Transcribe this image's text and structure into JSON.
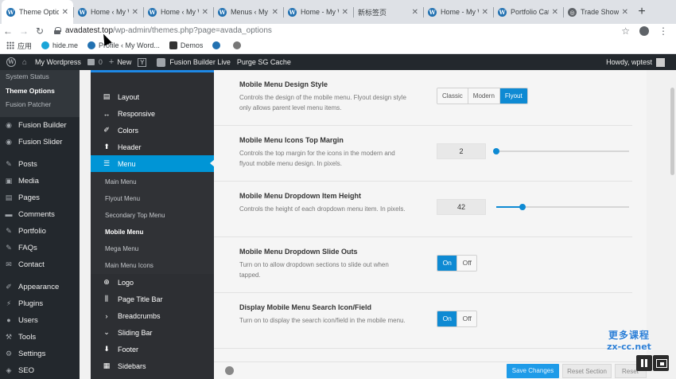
{
  "browser": {
    "tabs": [
      {
        "label": "Theme Optio",
        "icon": "wordpress-icon",
        "active": true
      },
      {
        "label": "Home ‹ My W",
        "icon": "wordpress-icon"
      },
      {
        "label": "Home ‹ My W",
        "icon": "wordpress-icon"
      },
      {
        "label": "Menus ‹ My W",
        "icon": "wordpress-icon"
      },
      {
        "label": "Home - My W",
        "icon": "wordpress-icon"
      },
      {
        "label": "新标签页",
        "icon": "none"
      },
      {
        "label": "Home - My W",
        "icon": "wordpress-icon"
      },
      {
        "label": "Portfolio Cat",
        "icon": "wordpress-icon"
      },
      {
        "label": "Trade Show E",
        "icon": "globe-icon"
      }
    ],
    "new_tab": "+",
    "url_host": "avadatest.top",
    "url_path": "/wp-admin/themes.php?page=avada_options",
    "bookmarks": [
      {
        "label": "应用",
        "icon": "apps-grid-icon"
      },
      {
        "label": "hide.me",
        "icon": "hideme-icon"
      },
      {
        "label": "Profile ‹ My Word...",
        "icon": "wordpress-icon"
      },
      {
        "label": "Demos",
        "icon": "avada-icon"
      },
      {
        "label": "",
        "icon": "wordpress-icon"
      },
      {
        "label": "",
        "icon": "settings-icon"
      }
    ]
  },
  "adminbar": {
    "site": "My Wordpress",
    "comments": "0",
    "new": "New",
    "fusion_live": "Fusion Builder Live",
    "purge": "Purge SG Cache",
    "howdy": "Howdy, wptest"
  },
  "wpmenu": {
    "sub": [
      "System Status",
      "Theme Options",
      "Fusion Patcher"
    ],
    "current_sub": "Theme Options",
    "items": [
      {
        "label": "Fusion Builder",
        "icon": "fusion-icon"
      },
      {
        "label": "Fusion Slider",
        "icon": "fusion-icon"
      },
      {
        "label": "Posts",
        "icon": "pin-icon"
      },
      {
        "label": "Media",
        "icon": "media-icon"
      },
      {
        "label": "Pages",
        "icon": "pages-icon"
      },
      {
        "label": "Comments",
        "icon": "comment-icon"
      },
      {
        "label": "Portfolio",
        "icon": "pin-icon"
      },
      {
        "label": "FAQs",
        "icon": "pin-icon"
      },
      {
        "label": "Contact",
        "icon": "mail-icon"
      },
      {
        "label": "Appearance",
        "icon": "brush-icon"
      },
      {
        "label": "Plugins",
        "icon": "plugin-icon"
      },
      {
        "label": "Users",
        "icon": "users-icon"
      },
      {
        "label": "Tools",
        "icon": "wrench-icon"
      },
      {
        "label": "Settings",
        "icon": "settings-icon"
      },
      {
        "label": "SEO",
        "icon": "seo-icon"
      }
    ]
  },
  "avada_sidebar": {
    "top_items": [
      {
        "label": "Layout",
        "icon": "layout-icon"
      },
      {
        "label": "Responsive",
        "icon": "arrows-horizontal-icon"
      },
      {
        "label": "Colors",
        "icon": "brush-icon"
      },
      {
        "label": "Header",
        "icon": "arrow-up-icon"
      },
      {
        "label": "Menu",
        "icon": "hamburger-icon",
        "active": true
      }
    ],
    "menu_subs": [
      "Main Menu",
      "Flyout Menu",
      "Secondary Top Menu",
      "Mobile Menu",
      "Mega Menu",
      "Main Menu Icons"
    ],
    "current_sub": "Mobile Menu",
    "bottom_items": [
      {
        "label": "Logo",
        "icon": "plus-circle-icon"
      },
      {
        "label": "Page Title Bar",
        "icon": "page-title-icon"
      },
      {
        "label": "Breadcrumbs",
        "icon": "chevron-right-icon"
      },
      {
        "label": "Sliding Bar",
        "icon": "chevron-down-icon"
      },
      {
        "label": "Footer",
        "icon": "arrow-down-icon"
      },
      {
        "label": "Sidebars",
        "icon": "sidebars-icon"
      }
    ]
  },
  "options": [
    {
      "title": "Mobile Menu Design Style",
      "desc": "Controls the design of the mobile menu. Flyout design style only allows parent level menu items.",
      "type": "buttonset",
      "choices": [
        "Classic",
        "Modern",
        "Flyout"
      ],
      "selected": "Flyout"
    },
    {
      "title": "Mobile Menu Icons Top Margin",
      "desc": "Controls the top margin for the icons in the modern and flyout mobile menu design. In pixels.",
      "type": "slider",
      "value": "2",
      "level": 0.0
    },
    {
      "title": "Mobile Menu Dropdown Item Height",
      "desc": "Controls the height of each dropdown menu item. In pixels.",
      "type": "slider",
      "value": "42",
      "level": 0.2
    },
    {
      "title": "Mobile Menu Dropdown Slide Outs",
      "desc": "Turn on to allow dropdown sections to slide out when tapped.",
      "type": "toggle",
      "on_label": "On",
      "off_label": "Off",
      "state": "On"
    },
    {
      "title": "Display Mobile Menu Search Icon/Field",
      "desc": "Turn on to display the search icon/field in the mobile menu.",
      "type": "toggle",
      "on_label": "On",
      "off_label": "Off",
      "state": "On"
    }
  ],
  "footer": {
    "save": "Save Changes",
    "reset_section": "Reset Section",
    "reset_all": "Reset All"
  },
  "watermark": {
    "line1": "更多课程",
    "line2": "zx-cc.net"
  }
}
